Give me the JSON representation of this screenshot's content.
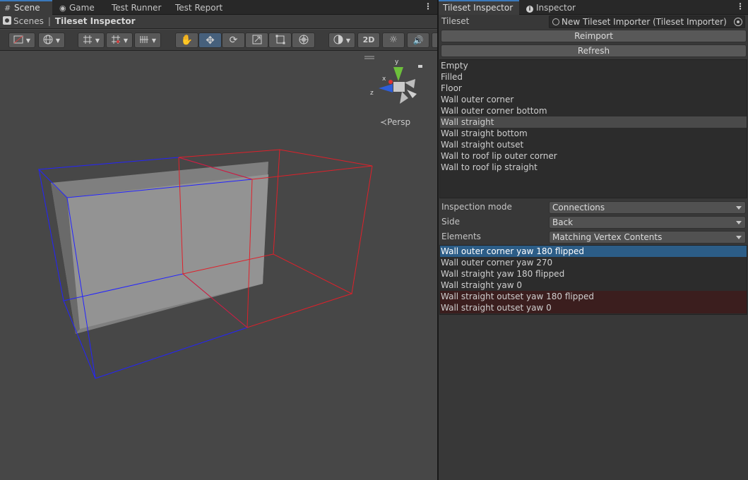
{
  "scene_tabs": [
    {
      "label": "Scene",
      "icon": "grid-icon"
    },
    {
      "label": "Game",
      "icon": "gamepad-icon"
    },
    {
      "label": "Test Runner",
      "icon": ""
    },
    {
      "label": "Test Report",
      "icon": ""
    }
  ],
  "breadcrumb": {
    "root": "Scenes",
    "separator": "|",
    "current": "Tileset Inspector"
  },
  "toolbar": {
    "mode_2d_label": "2D",
    "tools": [
      "draw-mode-icon",
      "globe-icon",
      "grid-snap-icon",
      "increment-snap-icon",
      "grid-icon",
      "hand-tool-icon",
      "move-tool-icon",
      "rotate-tool-icon",
      "scale-tool-icon",
      "rect-tool-icon",
      "transform-tool-icon",
      "render-mode-icon",
      "lighting-icon",
      "audio-icon"
    ]
  },
  "viewport": {
    "gizmo": {
      "x_label": "x",
      "y_label": "y",
      "z_label": "z"
    },
    "projection_label": "Persp"
  },
  "inspector_tabs": [
    {
      "label": "Tileset Inspector",
      "icon": ""
    },
    {
      "label": "Inspector",
      "icon": "info-icon"
    }
  ],
  "inspector": {
    "tileset_label": "Tileset",
    "tileset_value": "New Tileset Importer (Tileset Importer)",
    "reimport_label": "Reimport",
    "refresh_label": "Refresh",
    "tiles": [
      "Empty",
      "Filled",
      "Floor",
      "Wall outer corner",
      "Wall outer corner bottom",
      "Wall straight",
      "Wall straight bottom",
      "Wall straight outset",
      "Wall to roof lip outer corner",
      "Wall to roof lip straight"
    ],
    "highlighted_tile": "Wall straight",
    "inspection_mode_label": "Inspection mode",
    "inspection_mode_value": "Connections",
    "side_label": "Side",
    "side_value": "Back",
    "elements_label": "Elements",
    "elements_value": "Matching Vertex Contents",
    "connections": [
      {
        "label": "Wall outer corner yaw 180 flipped",
        "state": "selected"
      },
      {
        "label": "Wall outer corner yaw 270",
        "state": "normal"
      },
      {
        "label": "Wall straight yaw 180 flipped",
        "state": "normal"
      },
      {
        "label": "Wall straight yaw 0",
        "state": "normal"
      },
      {
        "label": "Wall straight outset yaw 180 flipped",
        "state": "mismatch"
      },
      {
        "label": "Wall straight outset yaw 0",
        "state": "mismatch"
      }
    ]
  },
  "colors": {
    "selection": "#2c5d87",
    "mismatch_row": "#3b1e1e",
    "wire_blue": "#2323ff",
    "wire_red": "#e0202a"
  }
}
